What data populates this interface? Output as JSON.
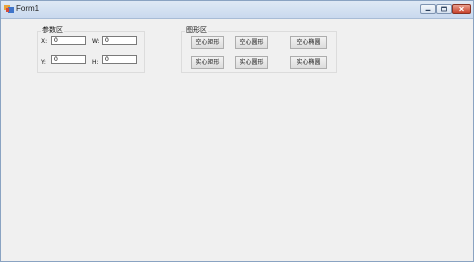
{
  "window": {
    "title": "Form1"
  },
  "params": {
    "caption": "参数区",
    "x_label": "X:",
    "x_value": "0",
    "w_label": "W:",
    "w_value": "0",
    "y_label": "Y:",
    "y_value": "0",
    "h_label": "H:",
    "h_value": "0"
  },
  "shapes": {
    "caption": "图形区",
    "buttons": [
      "空心矩形",
      "空心圆形",
      "空心椭圆",
      "实心矩形",
      "实心圆形",
      "实心椭圆"
    ]
  }
}
